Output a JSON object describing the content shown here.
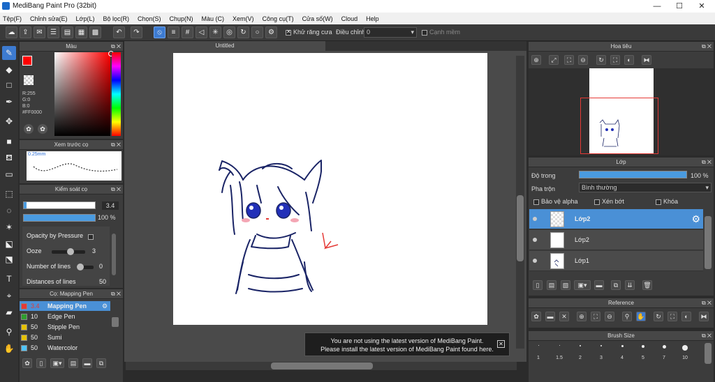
{
  "app": {
    "title": "MediBang Paint Pro (32bit)"
  },
  "menu": [
    "Tệp(F)",
    "Chỉnh sửa(E)",
    "Lớp(L)",
    "Bộ lọc(R)",
    "Chọn(S)",
    "Chụp(N)",
    "Màu (C)",
    "Xem(V)",
    "Công cụ(T)",
    "Cửa số(W)",
    "Cloud",
    "Help"
  ],
  "toolbar": {
    "antialias_label": "Khử răng cưa",
    "adjust_label": "Điều chỉnh",
    "adjust_value": "0",
    "soft_edge_label": "Cạnh mềm"
  },
  "color_panel": {
    "title": "Màu",
    "r": "R:255",
    "g": "G:0",
    "b": "B:0",
    "hex": "#FF0000",
    "primary_color": "#ff0000"
  },
  "brush_preview": {
    "title": "Xem trước cọ",
    "size": "0.25mm"
  },
  "brush_control": {
    "title": "Kiểm soát cọ",
    "size_value": "3.4",
    "opacity_value": "100 %",
    "opacity_pressure_label": "Opacity by Pressure",
    "ooze_label": "Ooze",
    "ooze_value": "3",
    "lines_label": "Number of lines",
    "lines_value": "0",
    "distance_label": "Distances of lines",
    "distance_value": "50"
  },
  "brush_list": {
    "title": "Cọ: Mapping Pen",
    "items": [
      {
        "size": "3.4",
        "name": "Mapping Pen",
        "color": "#e53935"
      },
      {
        "size": "10",
        "name": "Edge Pen",
        "color": "#2e9e2e"
      },
      {
        "size": "50",
        "name": "Stipple Pen",
        "color": "#e6c200"
      },
      {
        "size": "50",
        "name": "Sumi",
        "color": "#e6c200"
      },
      {
        "size": "50",
        "name": "Watercolor",
        "color": "#4fc3f7"
      }
    ]
  },
  "canvas": {
    "tab_title": "Untitled"
  },
  "notice": {
    "line1": "You are not using the latest version of MediBang Paint.",
    "line2": "Please install the latest version of MediBang Paint found here."
  },
  "navigator": {
    "title": "Hoa tiêu"
  },
  "layer_panel": {
    "title": "Lớp",
    "opacity_label": "Độ trong",
    "opacity_value": "100 %",
    "blend_label": "Pha trộn",
    "blend_value": "Bình thường",
    "protect_alpha": "Bảo vệ alpha",
    "clipping": "Xén bớt",
    "lock": "Khóa",
    "layers": [
      "Lớp2",
      "Lớp2",
      "Lớp1"
    ]
  },
  "reference": {
    "title": "Reference"
  },
  "brush_size": {
    "title": "Brush Size",
    "sizes": [
      "1",
      "1.5",
      "2",
      "3",
      "4",
      "5",
      "7",
      "10"
    ]
  }
}
